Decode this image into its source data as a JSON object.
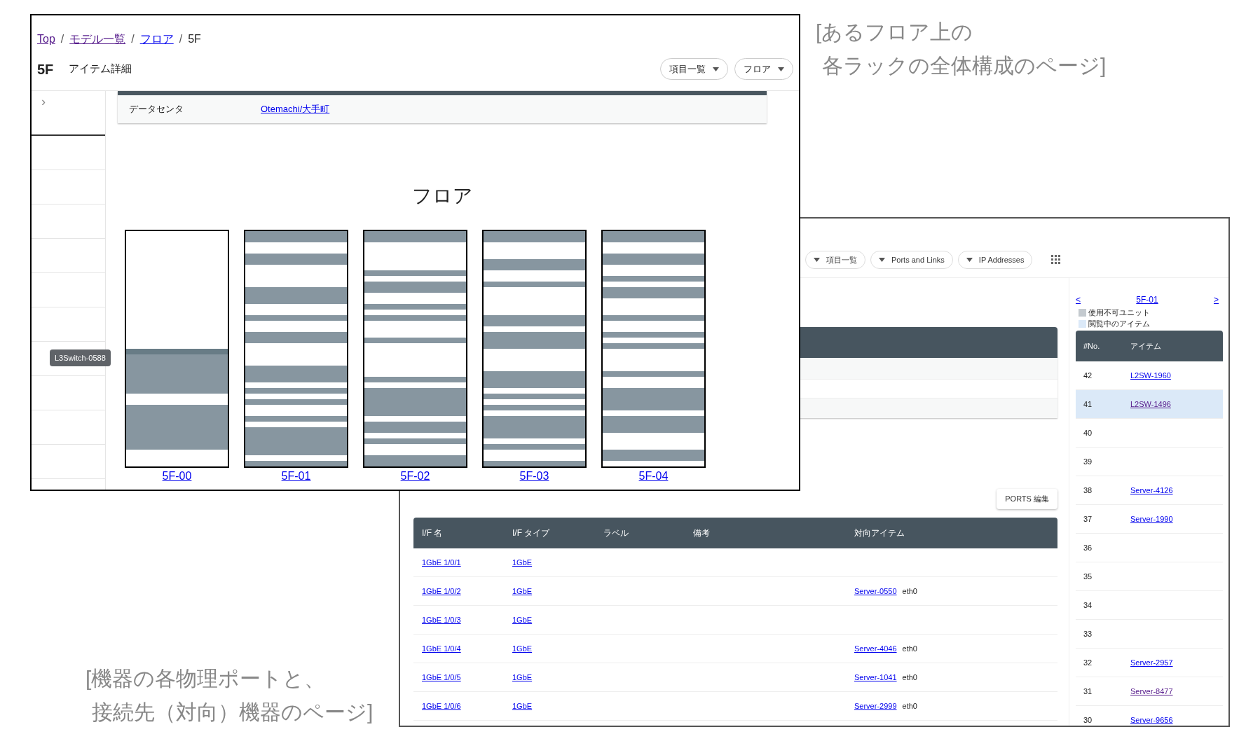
{
  "captions": [
    [
      "[あるフロア上の",
      "各ラックの全体構成のページ]"
    ],
    [
      "[機器の各物理ポートと、",
      "接続先（対向）機器のページ]"
    ]
  ],
  "floor_page": {
    "breadcrumb": [
      {
        "kind": "link",
        "label": "Top",
        "visited": true
      },
      {
        "kind": "sep",
        "label": "/"
      },
      {
        "kind": "link",
        "label": "モデル一覧",
        "visited": true
      },
      {
        "kind": "sep",
        "label": "/"
      },
      {
        "kind": "link",
        "label": "フロア",
        "visited": false
      },
      {
        "kind": "sep",
        "label": "/"
      },
      {
        "kind": "current",
        "label": "5F"
      }
    ],
    "title": "5F",
    "subtitle": "アイテム詳細",
    "buttons": [
      "項目一覧",
      "フロア"
    ],
    "sidebar_toggle": "›",
    "info": {
      "label": "データセンタ",
      "value": "Otemachi/大手町"
    },
    "heading": "フロア",
    "tooltip": "L3Switch-0588",
    "racks": [
      {
        "name": "5F-00",
        "units": [
          false,
          false,
          false,
          false,
          false,
          false,
          false,
          false,
          false,
          false,
          false,
          false,
          false,
          false,
          false,
          false,
          false,
          false,
          false,
          false,
          false,
          true,
          true,
          true,
          true,
          true,
          true,
          true,
          true,
          false,
          false,
          true,
          true,
          true,
          true,
          true,
          true,
          true,
          true,
          false,
          false,
          false
        ],
        "hovered": [
          false,
          false,
          false,
          false,
          false,
          false,
          false,
          false,
          false,
          false,
          false,
          false,
          false,
          false,
          false,
          false,
          false,
          false,
          false,
          false,
          false,
          true,
          false,
          false,
          false,
          false,
          false,
          false,
          false,
          false,
          false,
          false,
          false,
          false,
          false,
          false,
          false,
          false,
          false,
          false,
          false,
          false
        ]
      },
      {
        "name": "5F-01",
        "units": [
          true,
          true,
          false,
          false,
          true,
          true,
          false,
          false,
          false,
          false,
          true,
          true,
          true,
          false,
          false,
          true,
          false,
          false,
          true,
          true,
          false,
          false,
          false,
          false,
          true,
          true,
          true,
          false,
          true,
          false,
          true,
          false,
          false,
          true,
          false,
          true,
          true,
          true,
          true,
          true,
          false,
          true
        ]
      },
      {
        "name": "5F-02",
        "units": [
          true,
          true,
          false,
          false,
          false,
          false,
          false,
          true,
          false,
          true,
          true,
          false,
          false,
          true,
          false,
          true,
          false,
          false,
          false,
          true,
          false,
          false,
          false,
          false,
          false,
          false,
          true,
          false,
          true,
          true,
          true,
          true,
          true,
          false,
          true,
          true,
          false,
          true,
          false,
          false,
          true,
          true
        ]
      },
      {
        "name": "5F-03",
        "units": [
          true,
          true,
          false,
          false,
          false,
          true,
          true,
          false,
          false,
          true,
          false,
          false,
          false,
          false,
          false,
          true,
          true,
          false,
          true,
          true,
          true,
          false,
          false,
          false,
          false,
          true,
          true,
          true,
          false,
          true,
          false,
          true,
          false,
          true,
          true,
          true,
          true,
          false,
          true,
          false,
          false,
          true
        ]
      },
      {
        "name": "5F-04",
        "units": [
          true,
          true,
          false,
          false,
          true,
          true,
          false,
          false,
          true,
          false,
          true,
          true,
          false,
          false,
          false,
          true,
          false,
          false,
          true,
          false,
          true,
          false,
          false,
          false,
          false,
          true,
          false,
          false,
          true,
          true,
          true,
          true,
          false,
          true,
          true,
          true,
          false,
          false,
          false,
          true,
          true,
          false
        ]
      }
    ]
  },
  "port_page": {
    "toolbar": [
      "項目一覧",
      "Ports and Links",
      "IP Addresses"
    ],
    "ports_button": "PORTS 編集",
    "columns": [
      "I/F 名",
      "I/F タイプ",
      "ラベル",
      "備考",
      "対向アイテム"
    ],
    "rows": [
      {
        "if_name": "1GbE 1/0/1",
        "if_type": "1GbE"
      },
      {
        "if_name": "1GbE 1/0/2",
        "if_type": "1GbE",
        "peer": "Server-0550",
        "peer_port": "eth0"
      },
      {
        "if_name": "1GbE 1/0/3",
        "if_type": "1GbE"
      },
      {
        "if_name": "1GbE 1/0/4",
        "if_type": "1GbE",
        "peer": "Server-4046",
        "peer_port": "eth0"
      },
      {
        "if_name": "1GbE 1/0/5",
        "if_type": "1GbE",
        "peer": "Server-1041",
        "peer_port": "eth0"
      },
      {
        "if_name": "1GbE 1/0/6",
        "if_type": "1GbE",
        "peer": "Server-2999",
        "peer_port": "eth0"
      }
    ],
    "rack_panel": {
      "prev": "<",
      "rack": "5F-01",
      "next": ">",
      "legend": [
        {
          "label": "使用不可ユニット",
          "color": "#c4cacf"
        },
        {
          "label": "閲覧中のアイテム",
          "color": "#dbe9f8"
        }
      ],
      "columns": [
        "#No.",
        "アイテム"
      ],
      "rows": [
        {
          "no": "42",
          "item": "L2SW-1960",
          "visited": false,
          "selected": false
        },
        {
          "no": "41",
          "item": "L2SW-1496",
          "visited": true,
          "selected": true
        },
        {
          "no": "40",
          "selected": false
        },
        {
          "no": "39",
          "selected": false
        },
        {
          "no": "38",
          "item": "Server-4126",
          "visited": false,
          "selected": false
        },
        {
          "no": "37",
          "item": "Server-1990",
          "visited": false,
          "selected": false
        },
        {
          "no": "36",
          "selected": false
        },
        {
          "no": "35",
          "selected": false
        },
        {
          "no": "34",
          "selected": false
        },
        {
          "no": "33",
          "selected": false
        },
        {
          "no": "32",
          "item": "Server-2957",
          "visited": false,
          "selected": false
        },
        {
          "no": "31",
          "item": "Server-8477",
          "visited": true,
          "selected": false
        },
        {
          "no": "30",
          "item": "Server-9656",
          "visited": false,
          "selected": false
        }
      ]
    }
  }
}
